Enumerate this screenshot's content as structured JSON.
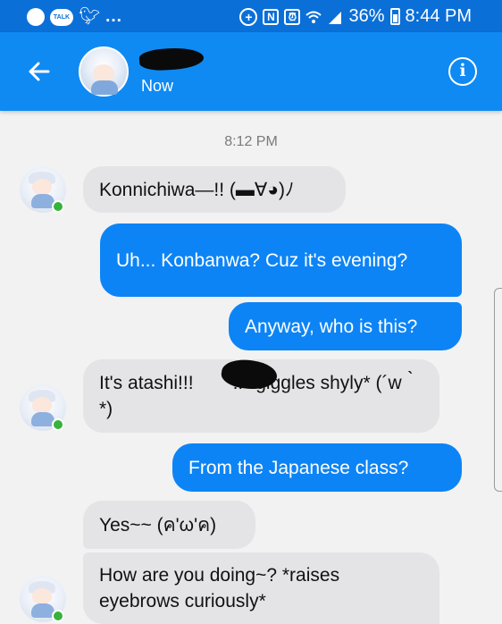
{
  "status_bar": {
    "left_icons": [
      "messenger-icon",
      "talk-icon",
      "twitter-icon",
      "more-notifications-icon"
    ],
    "talk_label": "TALK",
    "more_label": "...",
    "nfc_label": "N",
    "battery_percent": "36%",
    "time": "8:44 PM"
  },
  "header": {
    "back_icon": "arrow-left",
    "status": "Now",
    "info_icon": "info-circle"
  },
  "chat": {
    "timestamp": "8:12 PM",
    "messages": [
      {
        "direction": "incoming",
        "text": "Konnichiwa—!! (▬∀◕)ﾉ"
      },
      {
        "direction": "outgoing",
        "text": "Uh... Konbanwa? Cuz it's evening?"
      },
      {
        "direction": "outgoing",
        "text": "Anyway, who is this?"
      },
      {
        "direction": "incoming",
        "text_before": "It's atashi!!!",
        "text_after": "!! *giggles shyly* (´w｀*)"
      },
      {
        "direction": "outgoing",
        "text": "From the Japanese class?"
      },
      {
        "direction": "incoming",
        "text": "Yes~~ (ค'ω'ค)"
      },
      {
        "direction": "incoming",
        "text": "How are you doing~? *raises eyebrows curiously*"
      }
    ]
  },
  "colors": {
    "status_bar": "#0b6fd8",
    "header": "#0f8af3",
    "outgoing_bubble": "#0d84f5",
    "incoming_bubble": "#e4e4e6",
    "online": "#36b33a"
  }
}
